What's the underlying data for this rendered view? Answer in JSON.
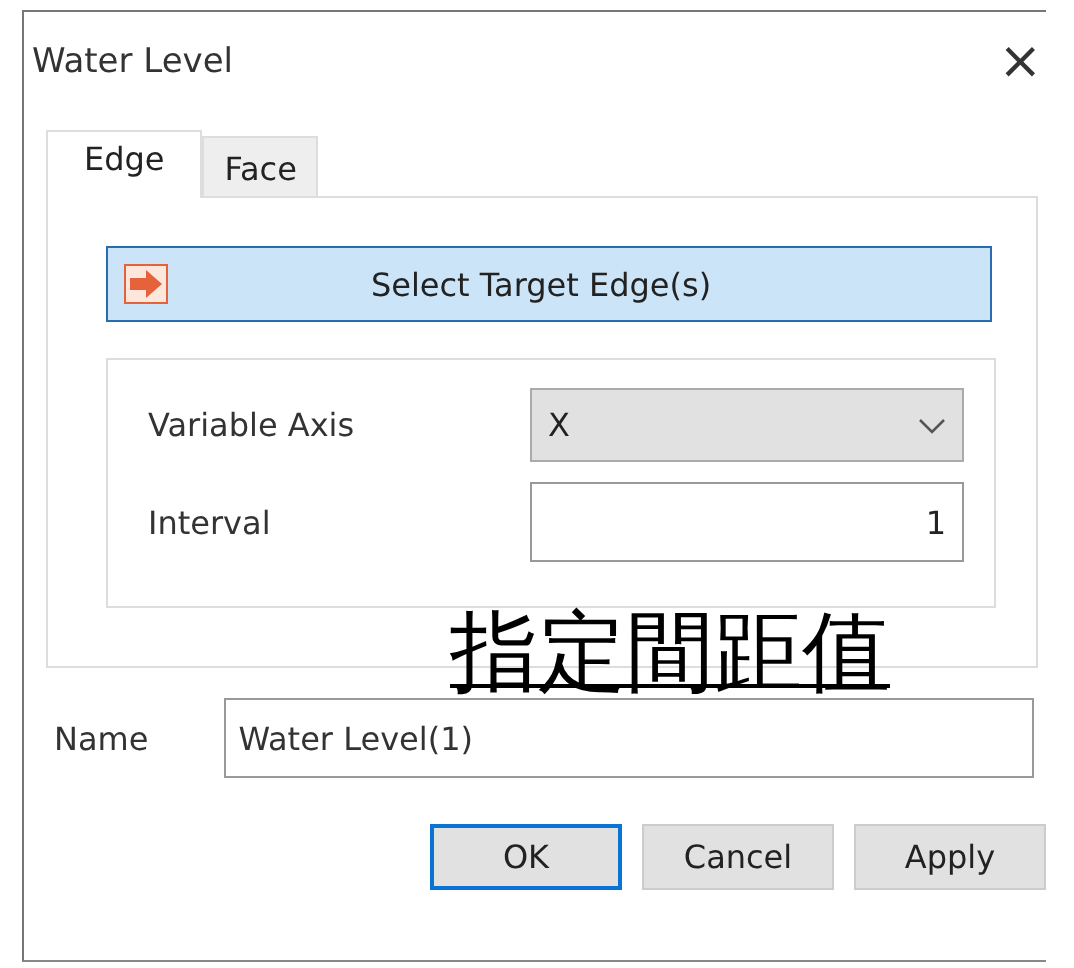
{
  "window": {
    "title": "Water Level",
    "close": "×"
  },
  "tabs": [
    {
      "label": "Edge",
      "selected": true
    },
    {
      "label": "Face",
      "selected": false
    }
  ],
  "select_button": {
    "label": "Select Target Edge(s)"
  },
  "fields": [
    {
      "kind": "dropdown",
      "label": "Variable Axis",
      "value": "X"
    },
    {
      "kind": "number",
      "label": "Interval",
      "value": "1"
    }
  ],
  "annotation": "指定間距值",
  "name_field": {
    "label": "Name",
    "value": "Water Level(1)"
  },
  "buttons": [
    {
      "label": "OK",
      "selected": true
    },
    {
      "label": "Cancel",
      "selected": false
    },
    {
      "label": "Apply",
      "selected": false
    }
  ]
}
